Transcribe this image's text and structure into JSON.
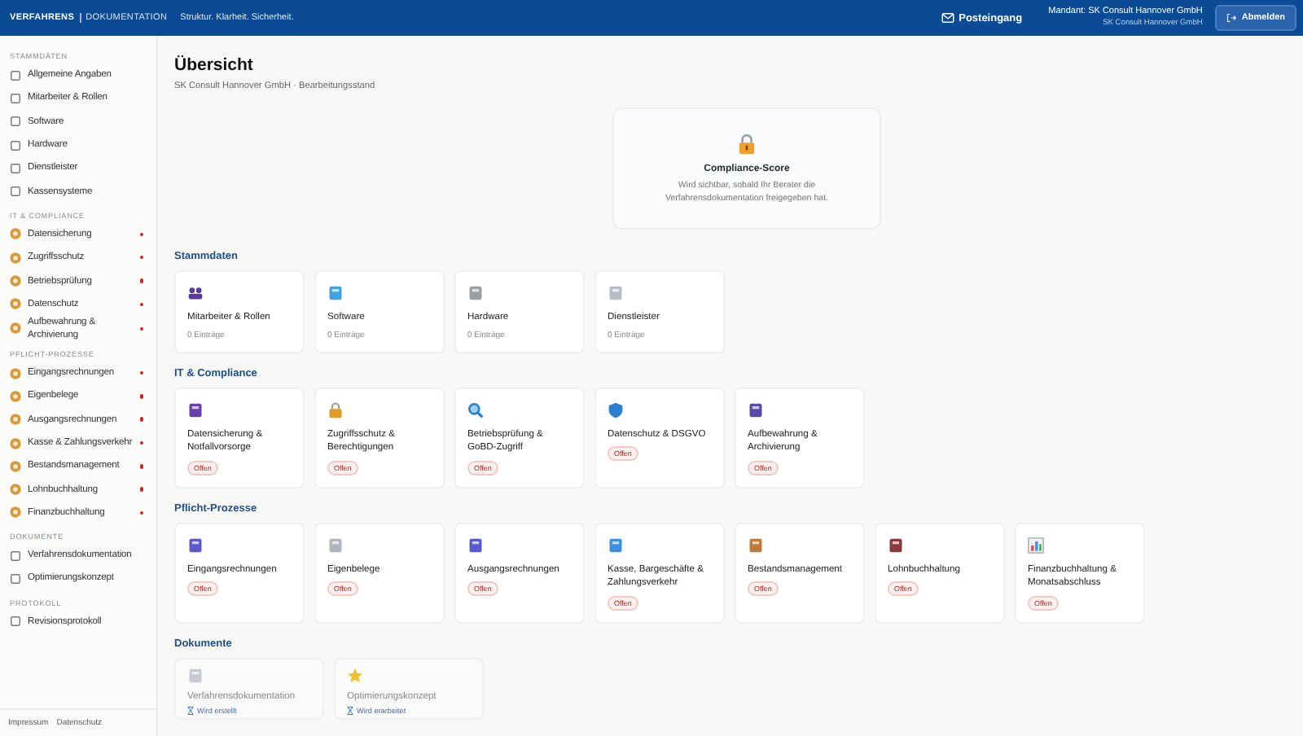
{
  "header": {
    "logo_primary": "VERFAHRENS",
    "logo_secondary": "DOKUMENTATION",
    "tagline": "Struktur. Klarheit. Sicherheit.",
    "inbox": "Posteingang",
    "client": "Mandant: SK Consult Hannover GmbH",
    "client_sub": "SK Consult Hannover GmbH",
    "logout": "Abmelden"
  },
  "sidebar": {
    "sections": [
      {
        "title": "STAMMDATEN",
        "items": [
          {
            "label": "Allgemeine Angaben",
            "kind": "link",
            "flagged": false
          },
          {
            "label": "Mitarbeiter & Rollen",
            "kind": "link",
            "flagged": false
          },
          {
            "label": "Software",
            "kind": "link",
            "flagged": false
          },
          {
            "label": "Hardware",
            "kind": "link",
            "flagged": false
          },
          {
            "label": "Dienstleister",
            "kind": "link",
            "flagged": false
          },
          {
            "label": "Kassensysteme",
            "kind": "link",
            "flagged": false
          }
        ]
      },
      {
        "title": "IT & COMPLIANCE",
        "items": [
          {
            "label": "Datensicherung",
            "kind": "task",
            "flagged": true
          },
          {
            "label": "Zugriffsschutz",
            "kind": "task",
            "flagged": true
          },
          {
            "label": "Betriebsprüfung",
            "kind": "task",
            "flagged": true
          },
          {
            "label": "Datenschutz",
            "kind": "task",
            "flagged": true
          },
          {
            "label": "Aufbewahrung & Archivierung",
            "kind": "task",
            "flagged": true
          }
        ]
      },
      {
        "title": "PFLICHT-PROZESSE",
        "items": [
          {
            "label": "Eingangsrechnungen",
            "kind": "task",
            "flagged": true
          },
          {
            "label": "Eigenbelege",
            "kind": "task",
            "flagged": true
          },
          {
            "label": "Ausgangsrechnungen",
            "kind": "task",
            "flagged": true
          },
          {
            "label": "Kasse & Zahlungsverkehr",
            "kind": "task",
            "flagged": true
          },
          {
            "label": "Bestandsmanagement",
            "kind": "task",
            "flagged": true
          },
          {
            "label": "Lohnbuchhaltung",
            "kind": "task",
            "flagged": true
          },
          {
            "label": "Finanzbuchhaltung",
            "kind": "task",
            "flagged": true
          }
        ]
      },
      {
        "title": "DOKUMENTE",
        "items": [
          {
            "label": "Verfahrensdokumentation",
            "kind": "link",
            "flagged": false
          },
          {
            "label": "Optimierungskonzept",
            "kind": "link",
            "flagged": false
          }
        ]
      },
      {
        "title": "PROTOKOLL",
        "items": [
          {
            "label": "Revisionsprotokoll",
            "kind": "link",
            "flagged": false
          }
        ]
      }
    ],
    "footer_links": [
      "Impressum",
      "Datenschutz"
    ]
  },
  "page": {
    "title": "Übersicht",
    "subtitle": "SK Consult Hannover GmbH · Bearbeitungsstand"
  },
  "score_card": {
    "title": "Compliance-Score",
    "text": "Wird sichtbar, sobald Ihr Berater die Verfahrensdokumentation freigegeben hat."
  },
  "sections": [
    {
      "title": "Stammdaten",
      "cards": [
        {
          "title": "Mitarbeiter & Rollen",
          "kind": "count",
          "meta": "0 Einträge"
        },
        {
          "title": "Software",
          "kind": "count",
          "meta": "0 Einträge"
        },
        {
          "title": "Hardware",
          "kind": "count",
          "meta": "0 Einträge"
        },
        {
          "title": "Dienstleister",
          "kind": "count",
          "meta": "0 Einträge"
        }
      ]
    },
    {
      "title": "IT & Compliance",
      "cards": [
        {
          "title": "Datensicherung & Notfallvorsorge",
          "kind": "status",
          "meta": "Offen"
        },
        {
          "title": "Zugriffsschutz & Berechtigungen",
          "kind": "status",
          "meta": "Offen"
        },
        {
          "title": "Betriebsprüfung & GoBD-Zugriff",
          "kind": "status",
          "meta": "Offen"
        },
        {
          "title": "Datenschutz & DSGVO",
          "kind": "status",
          "meta": "Offen"
        },
        {
          "title": "Aufbewahrung & Archivierung",
          "kind": "status",
          "meta": "Offen"
        }
      ]
    },
    {
      "title": "Pflicht-Prozesse",
      "cards": [
        {
          "title": "Eingangsrechnungen",
          "kind": "status",
          "meta": "Offen"
        },
        {
          "title": "Eigenbelege",
          "kind": "status",
          "meta": "Offen"
        },
        {
          "title": "Ausgangsrechnungen",
          "kind": "status",
          "meta": "Offen"
        },
        {
          "title": "Kasse, Bargeschäfte & Zahlungsverkehr",
          "kind": "status",
          "meta": "Offen"
        },
        {
          "title": "Bestandsmanagement",
          "kind": "status",
          "meta": "Offen"
        },
        {
          "title": "Lohnbuchhaltung",
          "kind": "status",
          "meta": "Offen"
        },
        {
          "title": "Finanzbuchhaltung & Monatsabschluss",
          "kind": "status",
          "meta": "Offen"
        }
      ]
    },
    {
      "title": "Dokumente",
      "cards": [
        {
          "title": "Verfahrensdokumentation",
          "kind": "doc",
          "meta": "Wird erstellt"
        },
        {
          "title": "Optimierungskonzept",
          "kind": "doc",
          "meta": "Wird erarbeitet"
        }
      ]
    }
  ]
}
